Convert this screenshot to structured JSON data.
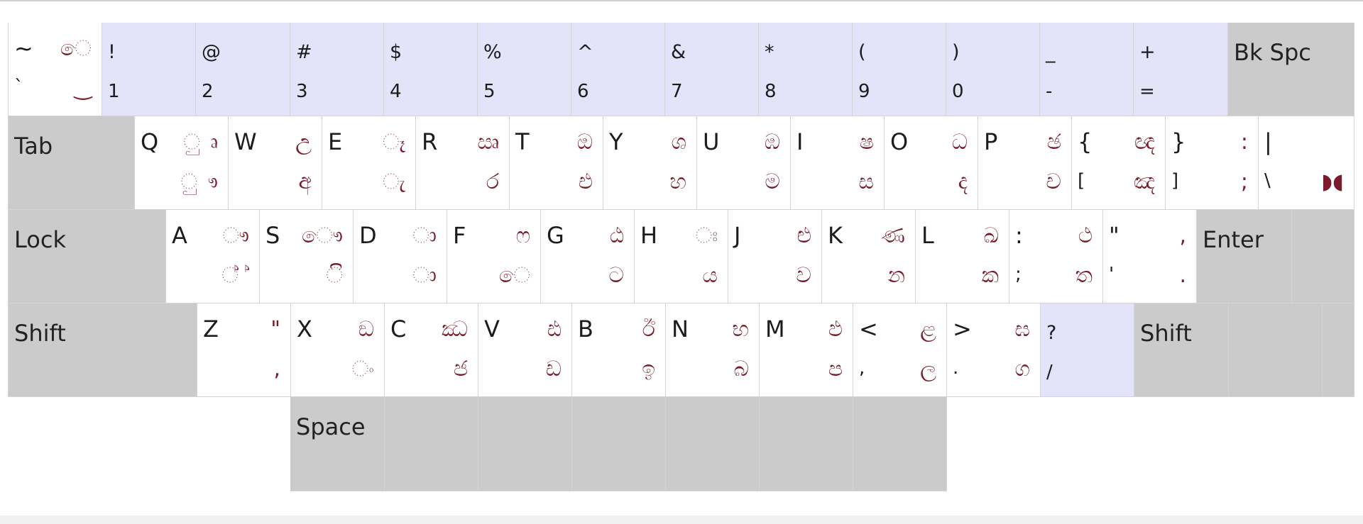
{
  "keyboard": {
    "colors": {
      "char_key": "#ffffff",
      "number_key": "#e3e3f9",
      "function_key": "#cbcbcb",
      "sinhala_glyph": "#7a1a2a",
      "latin_glyph": "#1c1c1c"
    },
    "rows": [
      {
        "name": "number",
        "keys": [
          {
            "id": "backtick",
            "kind": "char",
            "shift": "~",
            "base": "`",
            "si_shift": "ෙ",
            "si_base": "‿"
          },
          {
            "id": "1",
            "kind": "num",
            "shift": "!",
            "base": "1"
          },
          {
            "id": "2",
            "kind": "num",
            "shift": "@",
            "base": "2"
          },
          {
            "id": "3",
            "kind": "num",
            "shift": "#",
            "base": "3"
          },
          {
            "id": "4",
            "kind": "num",
            "shift": "$",
            "base": "4"
          },
          {
            "id": "5",
            "kind": "num",
            "shift": "%",
            "base": "5"
          },
          {
            "id": "6",
            "kind": "num",
            "shift": "^",
            "base": "6"
          },
          {
            "id": "7",
            "kind": "num",
            "shift": "&",
            "base": "7"
          },
          {
            "id": "8",
            "kind": "num",
            "shift": "*",
            "base": "8"
          },
          {
            "id": "9",
            "kind": "num",
            "shift": "(",
            "base": "9"
          },
          {
            "id": "0",
            "kind": "num",
            "shift": ")",
            "base": "0"
          },
          {
            "id": "minus",
            "kind": "num",
            "shift": "_",
            "base": "-"
          },
          {
            "id": "equals",
            "kind": "num",
            "shift": "+",
            "base": "="
          },
          {
            "id": "backspace",
            "kind": "fn",
            "label": "Bk Spc"
          }
        ]
      },
      {
        "name": "top",
        "keys": [
          {
            "id": "tab",
            "kind": "fn",
            "label": "Tab"
          },
          {
            "id": "q",
            "kind": "char",
            "shift": "Q",
            "base": "",
            "si_shift": "ු ෘ",
            "si_base": "ු ෟ"
          },
          {
            "id": "w",
            "kind": "char",
            "shift": "W",
            "base": "",
            "si_shift": "උ",
            "si_base": "අ"
          },
          {
            "id": "e",
            "kind": "char",
            "shift": "E",
            "base": "",
            "si_shift": "ෑ",
            "si_base": "ැ"
          },
          {
            "id": "r",
            "kind": "char",
            "shift": "R",
            "base": "",
            "si_shift": "ඍ",
            "si_base": "ර"
          },
          {
            "id": "t",
            "kind": "char",
            "shift": "T",
            "base": "",
            "si_shift": "ඔ",
            "si_base": "එ"
          },
          {
            "id": "y",
            "kind": "char",
            "shift": "Y",
            "base": "",
            "si_shift": "ශ",
            "si_base": "හ"
          },
          {
            "id": "u",
            "kind": "char",
            "shift": "U",
            "base": "",
            "si_shift": "ඹ",
            "si_base": "ම"
          },
          {
            "id": "i",
            "kind": "char",
            "shift": "I",
            "base": "",
            "si_shift": "ෂ",
            "si_base": "ස"
          },
          {
            "id": "o",
            "kind": "char",
            "shift": "O",
            "base": "",
            "si_shift": "ධ",
            "si_base": "ද"
          },
          {
            "id": "p",
            "kind": "char",
            "shift": "P",
            "base": "",
            "si_shift": "ඡ",
            "si_base": "ච"
          },
          {
            "id": "lbracket",
            "kind": "char",
            "shift": "{",
            "base": "[",
            "si_shift": "ඥ",
            "si_base": "ඤ"
          },
          {
            "id": "rbracket",
            "kind": "char",
            "shift": "}",
            "base": "]",
            "si_shift": ":",
            "si_base": ";"
          },
          {
            "id": "backslash",
            "kind": "char",
            "shift": "|",
            "base": "\\",
            "si_shift": "",
            "si_base": "◗◖"
          }
        ]
      },
      {
        "name": "home",
        "keys": [
          {
            "id": "caps",
            "kind": "fn",
            "label": "Lock"
          },
          {
            "id": "a",
            "kind": "char",
            "shift": "A",
            "base": "",
            "si_shift": "ෟ",
            "si_base": "් ්"
          },
          {
            "id": "s",
            "kind": "char",
            "shift": "S",
            "base": "",
            "si_shift": "ෞ",
            "si_base": "ි"
          },
          {
            "id": "d",
            "kind": "char",
            "shift": "D",
            "base": "",
            "si_shift": "ා",
            "si_base": "ා"
          },
          {
            "id": "f",
            "kind": "char",
            "shift": "F",
            "base": "",
            "si_shift": "ෆ",
            "si_base": "ෙ"
          },
          {
            "id": "g",
            "kind": "char",
            "shift": "G",
            "base": "",
            "si_shift": "ඨ",
            "si_base": "ට"
          },
          {
            "id": "h",
            "kind": "char",
            "shift": "H",
            "base": "",
            "si_shift": "ඃ",
            "si_base": "ය"
          },
          {
            "id": "j",
            "kind": "char",
            "shift": "J",
            "base": "",
            "si_shift": "ළු",
            "si_base": "ව"
          },
          {
            "id": "k",
            "kind": "char",
            "shift": "K",
            "base": "",
            "si_shift": "ණ",
            "si_base": "න"
          },
          {
            "id": "l",
            "kind": "char",
            "shift": "L",
            "base": "",
            "si_shift": "ඛ",
            "si_base": "ක"
          },
          {
            "id": "semicolon",
            "kind": "char",
            "shift": ":",
            "base": ";",
            "si_shift": "ථ",
            "si_base": "ත"
          },
          {
            "id": "quote",
            "kind": "char",
            "shift": "\"",
            "base": "'",
            "si_shift": ",",
            "si_base": "."
          },
          {
            "id": "enter",
            "kind": "fn",
            "label": "Enter"
          }
        ]
      },
      {
        "name": "bottom",
        "keys": [
          {
            "id": "lshift",
            "kind": "fn",
            "label": "Shift"
          },
          {
            "id": "z",
            "kind": "char",
            "shift": "Z",
            "base": "",
            "si_shift": "\"",
            "si_base": ","
          },
          {
            "id": "x",
            "kind": "char",
            "shift": "X",
            "base": "",
            "si_shift": "ඞ",
            "si_base": "ං"
          },
          {
            "id": "c",
            "kind": "char",
            "shift": "C",
            "base": "",
            "si_shift": "ඣ",
            "si_base": "ජ"
          },
          {
            "id": "v",
            "kind": "char",
            "shift": "V",
            "base": "",
            "si_shift": "ඪ",
            "si_base": "ඩ"
          },
          {
            "id": "b",
            "kind": "char",
            "shift": "B",
            "base": "",
            "si_shift": "ඊ",
            "si_base": "ඉ"
          },
          {
            "id": "n",
            "kind": "char",
            "shift": "N",
            "base": "",
            "si_shift": "භ",
            "si_base": "බ"
          },
          {
            "id": "m",
            "kind": "char",
            "shift": "M",
            "base": "",
            "si_shift": "ඵ",
            "si_base": "ප"
          },
          {
            "id": "comma",
            "kind": "char",
            "shift": "<",
            "base": ",",
            "si_shift": "ළ",
            "si_base": "ල"
          },
          {
            "id": "period",
            "kind": "char",
            "shift": ">",
            "base": ".",
            "si_shift": "ඝ",
            "si_base": "ග"
          },
          {
            "id": "slash",
            "kind": "num",
            "shift": "?",
            "base": "/"
          },
          {
            "id": "rshift",
            "kind": "fn",
            "label": "Shift"
          }
        ]
      },
      {
        "name": "space",
        "keys": [
          {
            "id": "space",
            "kind": "fn",
            "label": "Space"
          }
        ]
      }
    ]
  }
}
